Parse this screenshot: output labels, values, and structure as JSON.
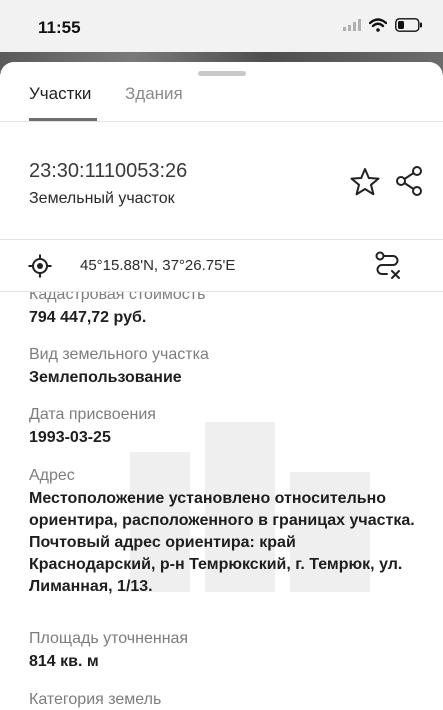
{
  "status_bar": {
    "time": "11:55"
  },
  "tabs": [
    {
      "label": "Участки",
      "active": true
    },
    {
      "label": "Здания",
      "active": false
    }
  ],
  "parcel": {
    "cadastral_number": "23:30:1110053:26",
    "type": "Земельный участок"
  },
  "location": {
    "coordinates": "45°15.88'N, 37°26.75'E"
  },
  "details": [
    {
      "label": "Кадастровая стоимость",
      "value": "794 447,72 руб."
    },
    {
      "label": "Вид земельного участка",
      "value": "Землепользование"
    },
    {
      "label": "Дата присвоения",
      "value": "1993-03-25"
    },
    {
      "label": "Адрес",
      "value": "Местоположение установлено относительно ориентира, расположенного в границах участка. Почтовый адрес ориентира: край Краснодарский, р-н Темрюкский, г. Темрюк, ул. Лиманная, 1/13."
    },
    {
      "label": "Площадь уточненная",
      "value": "814 кв. м"
    },
    {
      "label": "Категория земель",
      "value": ""
    }
  ],
  "colors": {
    "sheet_background": "#ffffff",
    "divider": "#e3e3e3",
    "label_gray": "#7d7d7d",
    "value_dark": "#1e1e1e"
  },
  "icons": {
    "status": [
      "cellular-signal-icon",
      "wifi-icon",
      "battery-icon"
    ],
    "header_actions": [
      "star-icon",
      "share-icon"
    ],
    "coords_row": [
      "locate-icon",
      "route-clear-icon"
    ]
  }
}
